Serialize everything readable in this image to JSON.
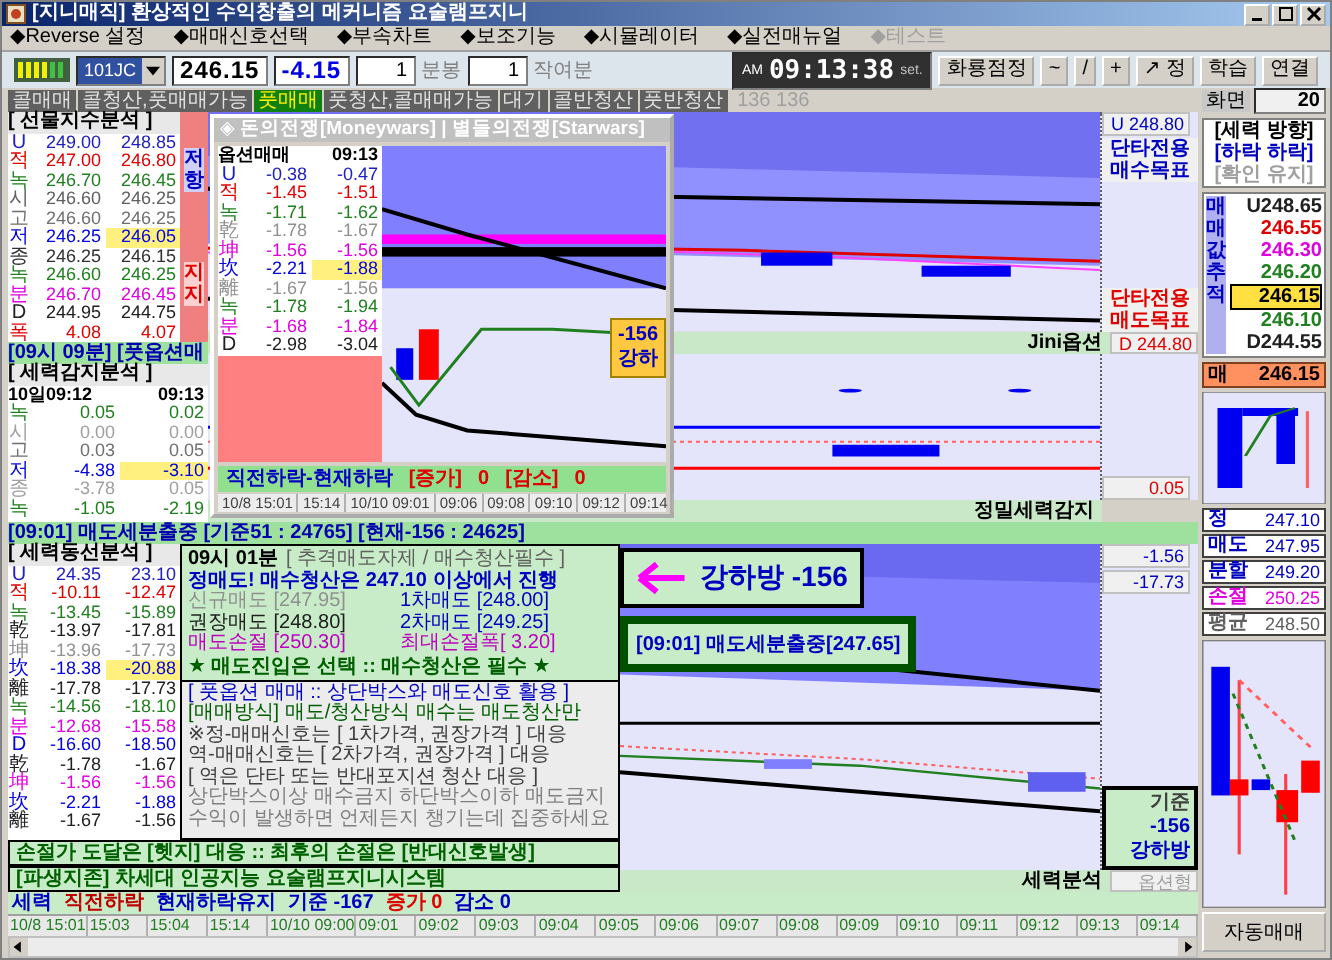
{
  "window": {
    "title": "[지니매직] 환상적인 수익창출의 메커니즘 요술램프지니"
  },
  "menu": [
    {
      "label": "◆Reverse 설정",
      "disabled": false
    },
    {
      "label": "◆매매신호선택",
      "disabled": false
    },
    {
      "label": "◆부속차트",
      "disabled": false
    },
    {
      "label": "◆보조기능",
      "disabled": false
    },
    {
      "label": "◆시뮬레이터",
      "disabled": false
    },
    {
      "label": "◆실전매뉴얼",
      "disabled": false
    },
    {
      "label": "◆테스트",
      "disabled": true
    }
  ],
  "toolbar": {
    "symbol": "101JC",
    "price": "246.15",
    "change": "-4.15",
    "period_value": "1",
    "period_unit": "분봉",
    "extra_value": "1",
    "extra_unit": "작여분",
    "clock_ampm": "AM",
    "clock": "09:13:38",
    "clock_tag": "set.",
    "buttons": [
      "화룡점정",
      "~",
      "/",
      "+",
      "↗ 정",
      "학습",
      "연결"
    ]
  },
  "signals": [
    {
      "label": "콜매매",
      "on": false
    },
    {
      "label": "콜청산,풋매매가능",
      "on": false
    },
    {
      "label": "풋매매",
      "on": true
    },
    {
      "label": "풋청산,콜매매가능",
      "on": false
    },
    {
      "label": "대기",
      "on": false
    },
    {
      "label": "콜반청산",
      "on": false
    },
    {
      "label": "풋반청산",
      "on": false
    }
  ],
  "signal_counter": "136 136",
  "screen": {
    "label": "화면",
    "value": "20"
  },
  "futures_panel": {
    "title": "[ 선물지수분석 ]",
    "resistance": "저항",
    "support": "지지",
    "rows": [
      {
        "label": "U",
        "v1": "249.00",
        "v2": "248.85",
        "color": "#2020c0",
        "highlight": false
      },
      {
        "label": "적",
        "v1": "247.00",
        "v2": "246.80",
        "color": "#e00000",
        "highlight": false
      },
      {
        "label": "녹",
        "v1": "246.70",
        "v2": "246.45",
        "color": "#208020",
        "highlight": false
      },
      {
        "label": "시",
        "v1": "246.60",
        "v2": "246.25",
        "color": "#606060",
        "highlight": false
      },
      {
        "label": "고",
        "v1": "246.60",
        "v2": "246.25",
        "color": "#707070",
        "highlight": false
      },
      {
        "label": "저",
        "v1": "246.25",
        "v2": "246.05",
        "color": "#0000e0",
        "highlight": true
      },
      {
        "label": "종",
        "v1": "246.25",
        "v2": "246.15",
        "color": "#303030",
        "highlight": false
      },
      {
        "label": "녹",
        "v1": "246.60",
        "v2": "246.25",
        "color": "#208020",
        "highlight": false
      },
      {
        "label": "분",
        "v1": "246.70",
        "v2": "246.45",
        "color": "#e000e0",
        "highlight": false
      },
      {
        "label": "D",
        "v1": "244.95",
        "v2": "244.75",
        "color": "#202020",
        "highlight": false
      },
      {
        "label": "폭",
        "v1": "4.08",
        "v2": "4.07",
        "color": "#e00000",
        "highlight": false
      }
    ],
    "banner": "[09시 09분] [풋옵션매"
  },
  "detect_panel": {
    "title": "[ 세력감지분석 ]",
    "head_1": "10일09:12",
    "head_2": "09:13",
    "rows": [
      {
        "label": "녹",
        "v1": "0.05",
        "v2": "0.02",
        "color": "#208020",
        "highlight": false
      },
      {
        "label": "시",
        "v1": "0.00",
        "v2": "0.00",
        "color": "#a0a0a0",
        "highlight": false
      },
      {
        "label": "고",
        "v1": "0.03",
        "v2": "0.05",
        "color": "#707070",
        "highlight": false
      },
      {
        "label": "저",
        "v1": "-4.38",
        "v2": "-3.10",
        "color": "#0000e0",
        "highlight": true
      },
      {
        "label": "종",
        "v1": "-3.78",
        "v2": "0.05",
        "color": "#a0a0a0",
        "highlight": false
      },
      {
        "label": "녹",
        "v1": "-1.05",
        "v2": "-2.19",
        "color": "#208020",
        "highlight": false
      }
    ]
  },
  "popup": {
    "title": "◈ 돈의전쟁[Moneywars] | 별들의전쟁[Starwars]",
    "head_1": "옵션매매",
    "head_2": "09:13",
    "rows": [
      {
        "label": "U",
        "v1": "-0.38",
        "v2": "-0.47",
        "color": "#2020c0",
        "highlight": false
      },
      {
        "label": "적",
        "v1": "-1.45",
        "v2": "-1.51",
        "color": "#e00000",
        "highlight": false
      },
      {
        "label": "녹",
        "v1": "-1.71",
        "v2": "-1.62",
        "color": "#208020",
        "highlight": false
      },
      {
        "label": "乾",
        "v1": "-1.78",
        "v2": "-1.67",
        "color": "#909090",
        "highlight": false
      },
      {
        "label": "坤",
        "v1": "-1.56",
        "v2": "-1.56",
        "color": "#e000e0",
        "highlight": false
      },
      {
        "label": "坎",
        "v1": "-2.21",
        "v2": "-1.88",
        "color": "#0000e0",
        "highlight": true
      },
      {
        "label": "離",
        "v1": "-1.67",
        "v2": "-1.56",
        "color": "#909090",
        "highlight": false
      },
      {
        "label": "녹",
        "v1": "-1.78",
        "v2": "-1.94",
        "color": "#208020",
        "highlight": false
      },
      {
        "label": "분",
        "v1": "-1.68",
        "v2": "-1.84",
        "color": "#e000e0",
        "highlight": false
      },
      {
        "label": "D",
        "v1": "-2.98",
        "v2": "-3.04",
        "color": "#202020",
        "highlight": false
      }
    ],
    "badge_value": "-156",
    "badge_text": "강하",
    "footer": [
      "직전하락-현재하락",
      "[증가]",
      "0",
      "[감소]",
      "0"
    ],
    "times": [
      "10/8 15:01",
      "15:14",
      "10/10 09:01",
      "09:06",
      "09:08",
      "09:10",
      "09:12",
      "09:14"
    ]
  },
  "top_chart": {
    "u_label": "U 248.80",
    "buy_target": "단타전용 매수목표",
    "sell_target": "단타전용 매도목표",
    "d_label": "D 244.80",
    "footer": "Jini옵션"
  },
  "middle_chart": {
    "value": "0.05",
    "footer": "정밀세력감지"
  },
  "flow_banner": "[09:01] 매도세분출중 [기준51 : 24765] [현재-156 : 24625]",
  "line_panel": {
    "title": "[ 세력동선분석 ]",
    "rows": [
      {
        "label": "U",
        "v1": "24.35",
        "v2": "23.10",
        "color": "#2020c0",
        "highlight": false
      },
      {
        "label": "적",
        "v1": "-10.11",
        "v2": "-12.47",
        "color": "#e00000",
        "highlight": false
      },
      {
        "label": "녹",
        "v1": "-13.45",
        "v2": "-15.89",
        "color": "#208020",
        "highlight": false
      },
      {
        "label": "乾",
        "v1": "-13.97",
        "v2": "-17.81",
        "color": "#202020",
        "highlight": false
      },
      {
        "label": "坤",
        "v1": "-13.96",
        "v2": "-17.73",
        "color": "#909090",
        "highlight": false
      },
      {
        "label": "坎",
        "v1": "-18.38",
        "v2": "-20.88",
        "color": "#0000e0",
        "highlight": true
      },
      {
        "label": "離",
        "v1": "-17.78",
        "v2": "-17.73",
        "color": "#202020",
        "highlight": false
      },
      {
        "label": "녹",
        "v1": "-14.56",
        "v2": "-18.10",
        "color": "#208020",
        "highlight": false
      },
      {
        "label": "분",
        "v1": "-12.68",
        "v2": "-15.58",
        "color": "#e000e0",
        "highlight": false
      },
      {
        "label": "D",
        "v1": "-16.60",
        "v2": "-18.50",
        "color": "#0000e0",
        "highlight": false
      },
      {
        "label": "乾",
        "v1": "-1.78",
        "v2": "-1.67",
        "color": "#202020",
        "highlight": false
      },
      {
        "label": "坤",
        "v1": "-1.56",
        "v2": "-1.56",
        "color": "#e000e0",
        "highlight": false
      },
      {
        "label": "坎",
        "v1": "-2.21",
        "v2": "-1.88",
        "color": "#0000e0",
        "highlight": false
      },
      {
        "label": "離",
        "v1": "-1.67",
        "v2": "-1.56",
        "color": "#202020",
        "highlight": false
      }
    ]
  },
  "strategy": {
    "heading": "09시 01분",
    "heading_note": "[ 추격매도자제 / 매수청산필수 ]",
    "main": "정매도! 매수청산은 247.10 이상에서 진행",
    "prices": [
      {
        "label": "신규매도 [247.95]",
        "color": "#909090"
      },
      {
        "label": "1차매도 [248.00]",
        "color": "#0000c0"
      },
      {
        "label": "권장매도 [248.80]",
        "color": "#202020"
      },
      {
        "label": "2차매도 [249.25]",
        "color": "#0000c0"
      },
      {
        "label": "매도손절 [250.30]",
        "color": "#c000c0"
      },
      {
        "label": "최대손절폭[ 3.20]",
        "color": "#c000c0"
      }
    ],
    "star_line": "★ 매도진입은 선택 :: 매수청산은 필수 ★",
    "rules": [
      {
        "text": "[ 풋옵션 매매 :: 상단박스와 매도신호 활용 ]",
        "color": "#0000c0"
      },
      {
        "text": "[매매방식] 매도/청산방식 매수는 매도청산만",
        "color": "#006000"
      },
      {
        "text": "※정-매매신호는 [ 1차가격, 권장가격 ] 대응",
        "color": "#404040"
      },
      {
        "text": "역-매매신호는 [ 2차가격, 권장가격 ] 대응",
        "color": "#404040"
      },
      {
        "text": "[ 역은 단타 또는 반대포지션 청산 대응 ]",
        "color": "#404040"
      },
      {
        "text": "상단박스이상 매수금지 하단박스이하 매도금지",
        "color": "#808080"
      },
      {
        "text": "수익이 발생하면 언제든지 챙기는데 집중하세요",
        "color": "#808080"
      }
    ]
  },
  "stripes": [
    "손절가 도달은 [헷지] 대응 :: 최후의 손절은 [반대신호발생]",
    "[파생지존] 차세대 인공지능 요술램프지니시스템"
  ],
  "lower_chart": {
    "value_1": "-1.56",
    "value_2": "-17.73",
    "badge": "강하방 -156",
    "signal": "[09:01] 매도세분출중[247.65]",
    "base": [
      "기준",
      "-156",
      "강하방"
    ],
    "footer": "세력분석",
    "footer_2": "옵션형"
  },
  "status_bar": [
    {
      "text": "세력",
      "color": "#0000c0"
    },
    {
      "text": "직전하락",
      "color": "#c00000"
    },
    {
      "text": "현재하락유지",
      "color": "#0000c0"
    },
    {
      "text": "기준 -167",
      "color": "#0000c0"
    },
    {
      "text": "증가 0",
      "color": "#e00000"
    },
    {
      "text": "감소 0",
      "color": "#0000c0"
    }
  ],
  "times": [
    "10/8 15:01",
    "15:03",
    "15:04",
    "15:14",
    "10/10 09:00",
    "09:01",
    "09:02",
    "09:03",
    "09:04",
    "09:05",
    "09:06",
    "09:07",
    "09:08",
    "09:09",
    "09:10",
    "09:11",
    "09:12",
    "09:13",
    "09:14"
  ],
  "right": {
    "direction_title": "[세력 방향]",
    "direction": "[하락 하락]",
    "confirm": "[확인 유지]",
    "trace_label": "매매값추적",
    "trace": [
      {
        "text": "U248.65",
        "color": "#202020",
        "selected": false
      },
      {
        "text": "246.55",
        "color": "#e00000",
        "selected": false
      },
      {
        "text": "246.30",
        "color": "#e000e0",
        "selected": false
      },
      {
        "text": "246.20",
        "color": "#208020",
        "selected": false
      },
      {
        "text": "246.15",
        "color": "#000000",
        "selected": true
      },
      {
        "text": "246.10",
        "color": "#208020",
        "selected": false
      },
      {
        "text": "D244.55",
        "color": "#202020",
        "selected": false
      }
    ],
    "current_label": "매",
    "current": "246.15",
    "levels": [
      {
        "label": "정",
        "value": "247.10",
        "color": "#0000c0"
      },
      {
        "label": "매도",
        "value": "247.95",
        "color": "#0000c0"
      },
      {
        "label": "분할",
        "value": "249.20",
        "color": "#0000c0"
      },
      {
        "label": "손절",
        "value": "250.25",
        "color": "#e000e0"
      },
      {
        "label": "평균",
        "value": "248.50",
        "color": "#606060"
      }
    ],
    "auto_button": "자동매매"
  }
}
